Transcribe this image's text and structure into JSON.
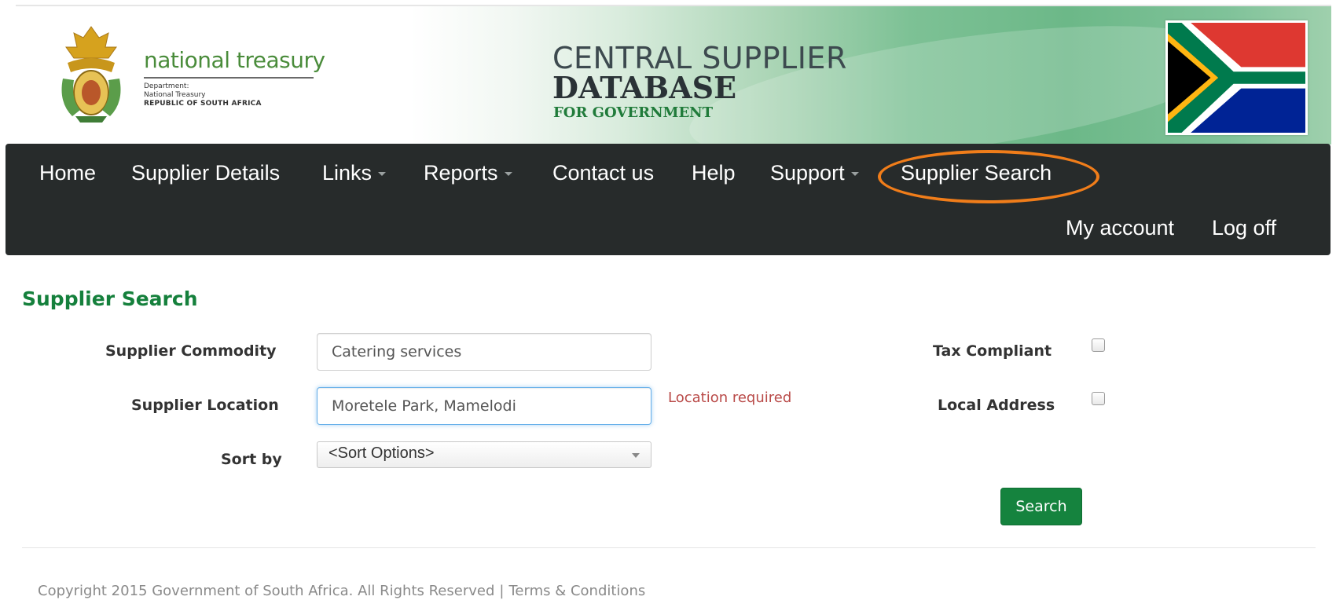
{
  "banner": {
    "department_name": "national treasury",
    "department_sub_1": "Department:",
    "department_sub_2": "National Treasury",
    "department_sub_3": "REPUBLIC OF SOUTH AFRICA",
    "db_title_1": "CENTRAL SUPPLIER",
    "db_title_2": "DATABASE",
    "db_title_3": "FOR GOVERNMENT"
  },
  "nav": {
    "items": [
      {
        "label": "Home",
        "dropdown": false
      },
      {
        "label": "Supplier Details",
        "dropdown": false
      },
      {
        "label": "Links",
        "dropdown": true
      },
      {
        "label": "Reports",
        "dropdown": true
      },
      {
        "label": "Contact us",
        "dropdown": false
      },
      {
        "label": "Help",
        "dropdown": false
      },
      {
        "label": "Support",
        "dropdown": true
      },
      {
        "label": "Supplier Search",
        "dropdown": false
      }
    ],
    "right_items": [
      {
        "label": "My account"
      },
      {
        "label": "Log off"
      }
    ],
    "highlight_color": "#f07d1a",
    "background": "#272b2b"
  },
  "search_form": {
    "title": "Supplier Search",
    "commodity_label": "Supplier Commodity",
    "commodity_value": "Catering services",
    "location_label": "Supplier Location",
    "location_value": "Moretele Park, Mamelodi",
    "location_error": "Location required",
    "sort_label": "Sort by",
    "sort_selected": "<Sort Options>",
    "tax_compliant_label": "Tax Compliant",
    "tax_compliant_checked": false,
    "local_address_label": "Local Address",
    "local_address_checked": false,
    "search_button": "Search",
    "accent_color": "#15803c"
  },
  "footer": {
    "copyright": "Copyright 2015 Government of South Africa. All Rights Reserved",
    "separator": "|",
    "terms": "Terms & Conditions"
  }
}
